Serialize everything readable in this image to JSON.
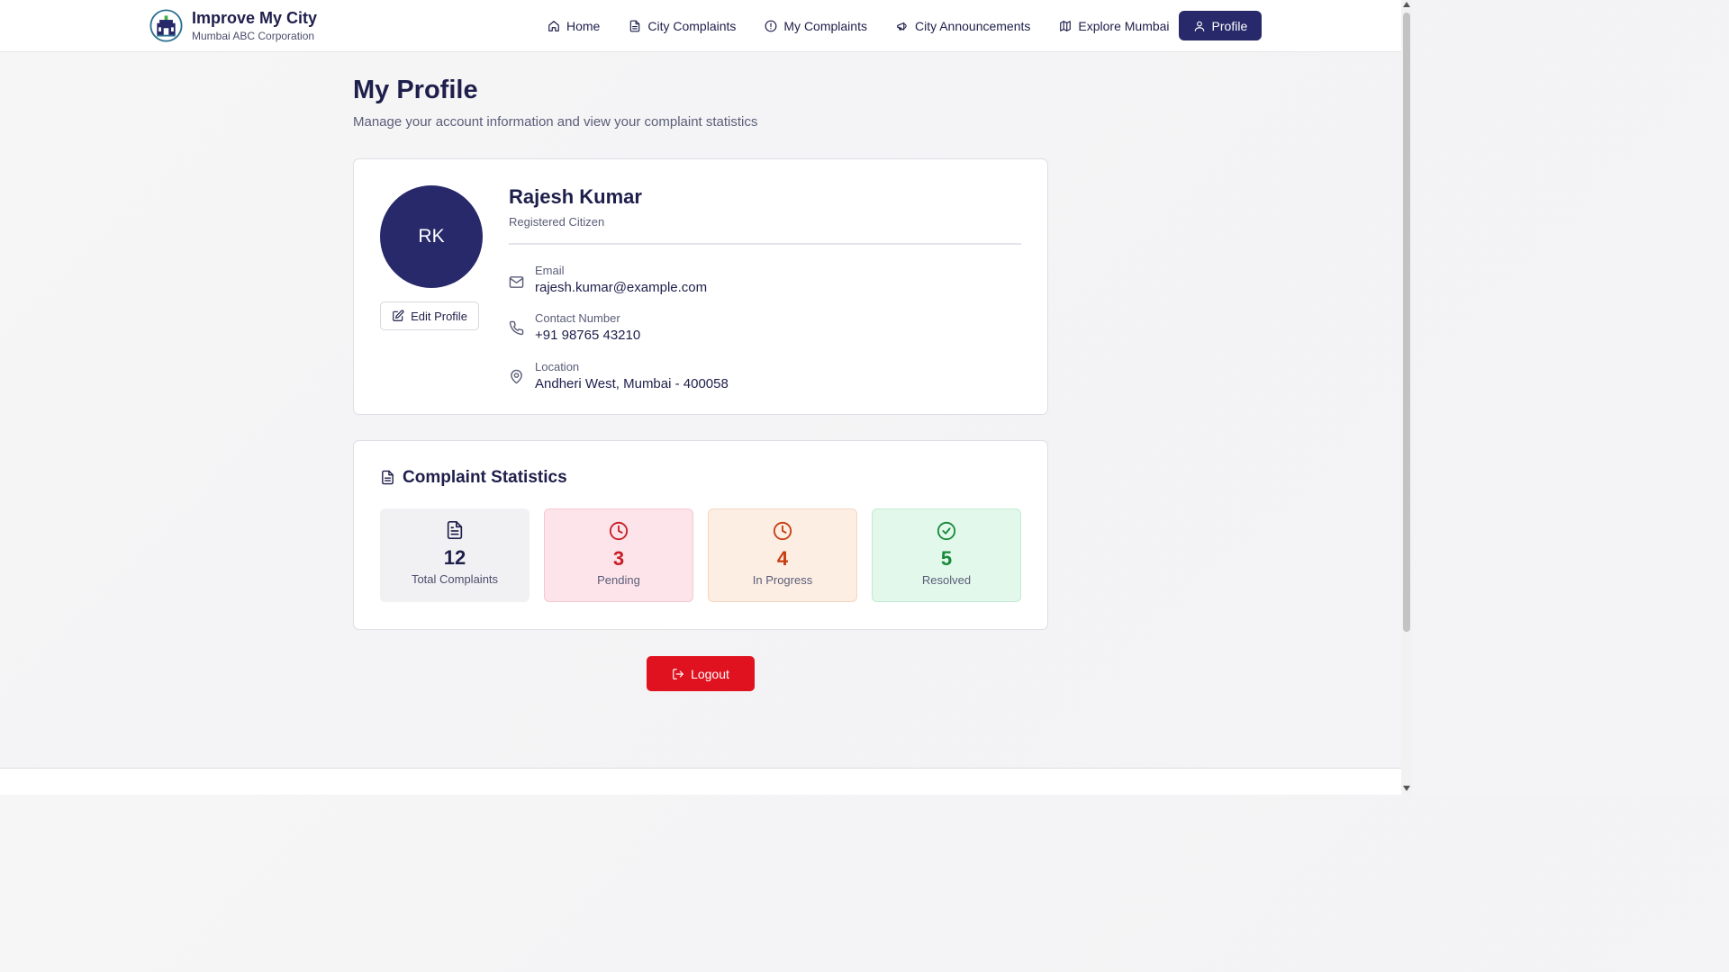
{
  "brand": {
    "title": "Improve My City",
    "subtitle": "Mumbai ABC Corporation"
  },
  "nav": {
    "items": [
      {
        "label": "Home",
        "icon": "home-icon"
      },
      {
        "label": "City Complaints",
        "icon": "document-icon"
      },
      {
        "label": "My Complaints",
        "icon": "alert-circle-icon"
      },
      {
        "label": "City Announcements",
        "icon": "megaphone-icon"
      },
      {
        "label": "Explore Mumbai",
        "icon": "map-icon"
      },
      {
        "label": "Profile",
        "icon": "user-icon",
        "active": true
      }
    ]
  },
  "page": {
    "title": "My Profile",
    "subtitle": "Manage your account information and view your complaint statistics"
  },
  "profile": {
    "initials": "RK",
    "name": "Rajesh Kumar",
    "role": "Registered Citizen",
    "edit_label": "Edit Profile",
    "email_label": "Email",
    "email": "rajesh.kumar@example.com",
    "phone_label": "Contact Number",
    "phone": "+91 98765 43210",
    "location_label": "Location",
    "location": "Andheri West, Mumbai - 400058"
  },
  "stats": {
    "title": "Complaint Statistics",
    "items": [
      {
        "value": "12",
        "label": "Total Complaints",
        "icon": "document-icon"
      },
      {
        "value": "3",
        "label": "Pending",
        "icon": "clock-icon"
      },
      {
        "value": "4",
        "label": "In Progress",
        "icon": "clock-icon"
      },
      {
        "value": "5",
        "label": "Resolved",
        "icon": "check-circle-icon"
      }
    ]
  },
  "logout_label": "Logout",
  "colors": {
    "primary": "#27296a",
    "danger": "#e0121f",
    "pending": "#c81d25",
    "in_progress": "#c63d12",
    "resolved": "#178a3b"
  }
}
